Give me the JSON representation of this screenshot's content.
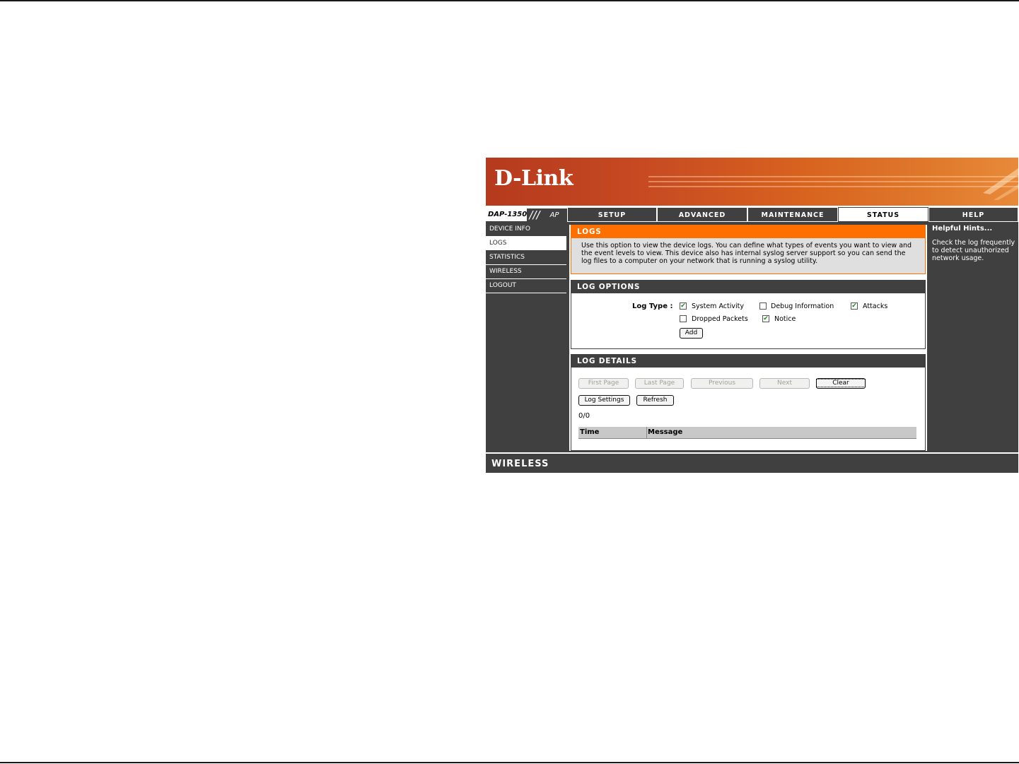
{
  "brand": {
    "logo": "D-Link",
    "model": "DAP-1350",
    "slashes": "///",
    "mode": "AP",
    "footer": "WIRELESS"
  },
  "tabs": [
    {
      "label": "SETUP"
    },
    {
      "label": "ADVANCED"
    },
    {
      "label": "MAINTENANCE"
    },
    {
      "label": "STATUS"
    },
    {
      "label": "HELP"
    }
  ],
  "sidebar": {
    "items": [
      {
        "label": "DEVICE INFO"
      },
      {
        "label": "LOGS"
      },
      {
        "label": "STATISTICS"
      },
      {
        "label": "WIRELESS"
      },
      {
        "label": "LOGOUT"
      }
    ]
  },
  "logs_section": {
    "title": "LOGS",
    "description": "Use this option to view the device logs. You can define what types of events you want to view and the event levels to view. This device also has internal syslog server support so you can send the log files to a computer on your network that is running a syslog utility."
  },
  "log_options": {
    "title": "LOG OPTIONS",
    "log_type_label": "Log Type :",
    "options": [
      {
        "label": "System Activity",
        "checked": true
      },
      {
        "label": "Debug Information",
        "checked": false
      },
      {
        "label": "Attacks",
        "checked": true
      },
      {
        "label": "Dropped Packets",
        "checked": false
      },
      {
        "label": "Notice",
        "checked": true
      }
    ],
    "add_label": "Add"
  },
  "log_details": {
    "title": "LOG DETAILS",
    "nav_buttons": {
      "first": "First Page",
      "last": "Last Page",
      "previous": "Previous",
      "next": "Next",
      "clear": "Clear"
    },
    "log_settings_label": "Log Settings",
    "refresh_label": "Refresh",
    "count": "0/0",
    "columns": [
      "Time",
      "Message"
    ]
  },
  "help": {
    "title": "Helpful Hints...",
    "text": "Check the log frequently to detect unauthorized network usage."
  },
  "colors": {
    "orange": "#ff6f00",
    "dark": "#404040",
    "check": "#1a8a1a"
  }
}
